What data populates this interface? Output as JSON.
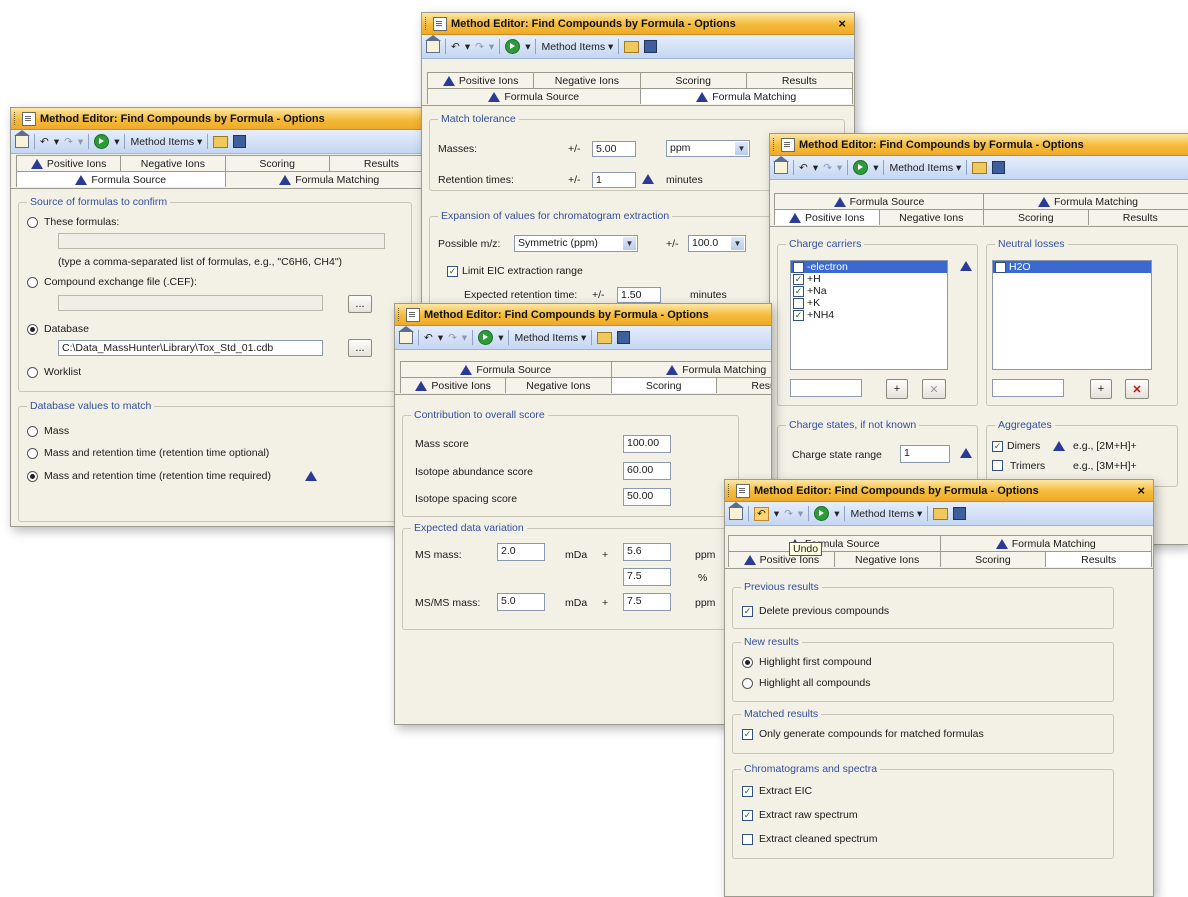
{
  "app": {
    "title": "Method Editor: Find Compounds by Formula - Options",
    "close_glyph": "×",
    "toolbar": {
      "method_items": "Method Items",
      "dropdown_glyph": "▾"
    }
  },
  "tabs": {
    "positive_ions": "Positive Ions",
    "negative_ions": "Negative Ions",
    "scoring": "Scoring",
    "results": "Results",
    "formula_source": "Formula Source",
    "formula_matching": "Formula Matching"
  },
  "formula_source": {
    "group1_title": "Source of formulas to confirm",
    "these_formulas": "These formulas:",
    "formulas_hint": "(type a comma-separated list of formulas, e.g., \"C6H6, CH4\")",
    "cef_label": "Compound exchange file (.CEF):",
    "database_label": "Database",
    "database_path": "C:\\Data_MassHunter\\Library\\Tox_Std_01.cdb",
    "worklist_label": "Worklist",
    "browse_label": "...",
    "group2_title": "Database values to match",
    "mass_label": "Mass",
    "mass_rt_optional": "Mass and retention time (retention time optional)",
    "mass_rt_required": "Mass and retention time (retention time required)"
  },
  "formula_matching": {
    "group1_title": "Match tolerance",
    "masses_label": "Masses:",
    "pm": "+/-",
    "masses_value": "5.00",
    "masses_unit": "ppm",
    "rt_label": "Retention times:",
    "rt_value": "1",
    "rt_unit": "minutes",
    "group2_title": "Expansion of values for chromatogram extraction",
    "possible_mz_label": "Possible m/z:",
    "possible_mz_value": "Symmetric (ppm)",
    "possible_mz_pm_value": "100.0",
    "limit_eic_label": "Limit EIC extraction range",
    "expected_rt_label": "Expected retention time:",
    "expected_rt_value": "1.50",
    "expected_rt_unit": "minutes"
  },
  "positive_ions": {
    "charge_carriers_title": "Charge carriers",
    "charge_carriers": [
      {
        "label": "-electron",
        "checked": false,
        "highlight": true
      },
      {
        "label": "+H",
        "checked": true,
        "highlight": false
      },
      {
        "label": "+Na",
        "checked": true,
        "highlight": false
      },
      {
        "label": "+K",
        "checked": false,
        "highlight": false
      },
      {
        "label": "+NH4",
        "checked": true,
        "highlight": false
      }
    ],
    "neutral_losses_title": "Neutral losses",
    "neutral_losses": [
      {
        "label": "H2O",
        "checked": false,
        "highlight": true
      }
    ],
    "add_glyph": "+",
    "remove_glyph": "✕",
    "charge_states_title": "Charge states, if not known",
    "charge_state_range_label": "Charge state range",
    "charge_state_range_value": "1",
    "aggregates_title": "Aggregates",
    "dimers_label": "Dimers",
    "dimers_example": "e.g., [2M+H]+",
    "trimers_label": "Trimers",
    "trimers_example": "e.g., [3M+H]+"
  },
  "scoring": {
    "group1_title": "Contribution to overall score",
    "mass_score_label": "Mass score",
    "mass_score_value": "100.00",
    "isotope_abundance_label": "Isotope abundance score",
    "isotope_abundance_value": "60.00",
    "isotope_spacing_label": "Isotope spacing score",
    "isotope_spacing_value": "50.00",
    "group2_title": "Expected data variation",
    "ms_mass_label": "MS mass:",
    "ms_mass_mda": "2.0",
    "mda_unit": "mDa",
    "plus": "+",
    "ms_mass_ppm": "5.6",
    "ppm_unit": "ppm",
    "pct_value": "7.5",
    "pct_unit": "%",
    "msms_mass_label": "MS/MS mass:",
    "msms_mass_mda": "5.0",
    "msms_mass_ppm": "7.5"
  },
  "results": {
    "tooltip": "Undo",
    "previous_results_title": "Previous results",
    "delete_previous": "Delete previous compounds",
    "new_results_title": "New results",
    "highlight_first": "Highlight first compound",
    "highlight_all": "Highlight all compounds",
    "matched_results_title": "Matched results",
    "only_generate": "Only generate compounds for matched formulas",
    "chromatograms_title": "Chromatograms and spectra",
    "extract_eic": "Extract EIC",
    "extract_raw": "Extract raw spectrum",
    "extract_cleaned": "Extract cleaned spectrum"
  }
}
